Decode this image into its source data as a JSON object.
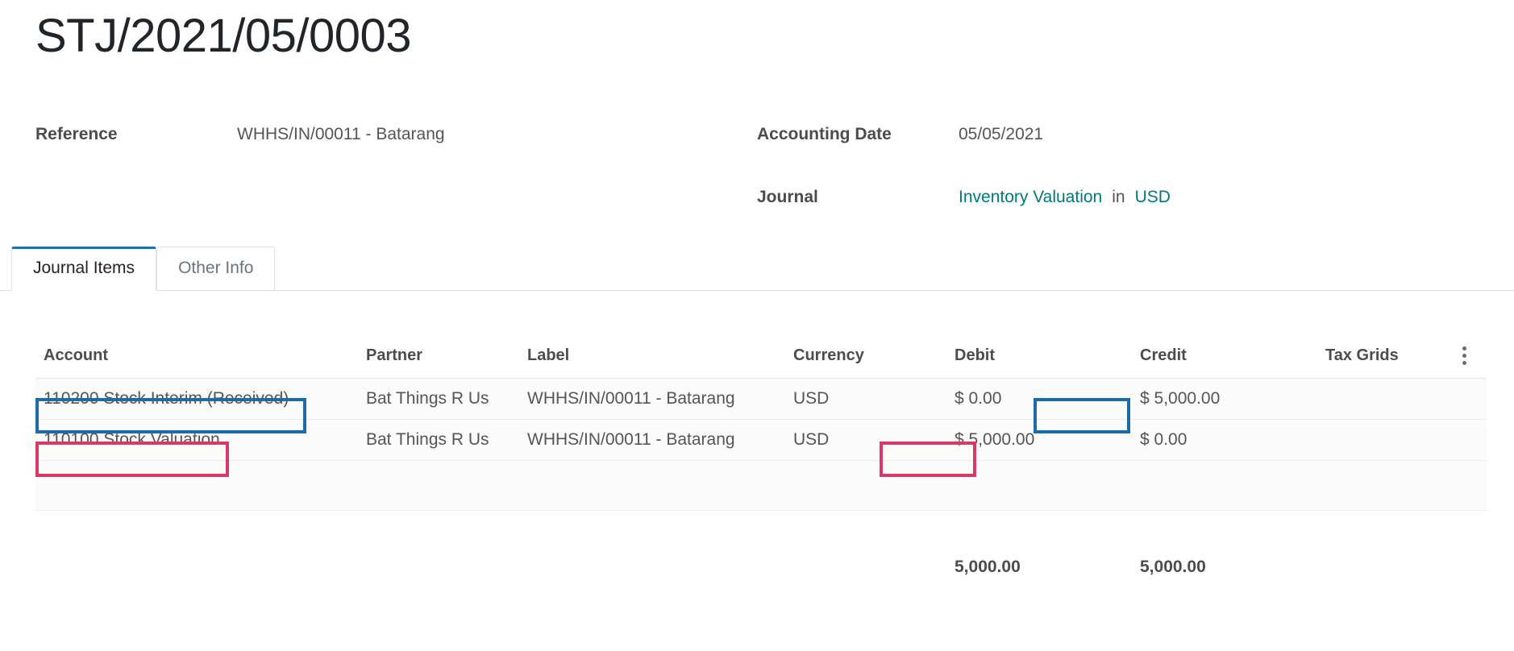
{
  "document": {
    "title": "STJ/2021/05/0003"
  },
  "header": {
    "reference_label": "Reference",
    "reference_value": "WHHS/IN/00011 - Batarang",
    "accounting_date_label": "Accounting Date",
    "accounting_date_value": "05/05/2021",
    "journal_label": "Journal",
    "journal_value": "Inventory Valuation",
    "journal_separator": "in",
    "journal_currency": "USD"
  },
  "tabs": [
    {
      "label": "Journal Items",
      "active": true
    },
    {
      "label": "Other Info",
      "active": false
    }
  ],
  "table": {
    "columns": [
      "Account",
      "Partner",
      "Label",
      "Currency",
      "Debit",
      "Credit",
      "Tax Grids"
    ],
    "rows": [
      {
        "account": "110200 Stock Interim (Received)",
        "partner": "Bat Things R Us",
        "label": "WHHS/IN/00011 - Batarang",
        "currency": "USD",
        "debit": "$ 0.00",
        "credit": "$ 5,000.00",
        "tax_grids": ""
      },
      {
        "account": "110100 Stock Valuation",
        "partner": "Bat Things R Us",
        "label": "WHHS/IN/00011 - Batarang",
        "currency": "USD",
        "debit": "$ 5,000.00",
        "credit": "$ 0.00",
        "tax_grids": ""
      }
    ],
    "totals": {
      "debit": "5,000.00",
      "credit": "5,000.00"
    }
  },
  "annotations": {
    "blue_color": "#1b6ca8",
    "pink_color": "#d93965",
    "blue_targets": [
      "row-1-account",
      "row-1-credit"
    ],
    "pink_targets": [
      "row-2-account",
      "row-2-debit"
    ]
  },
  "colors": {
    "link": "#00787e",
    "tab_active_underline": "#1f6fab",
    "text": "#4c4c4c"
  }
}
